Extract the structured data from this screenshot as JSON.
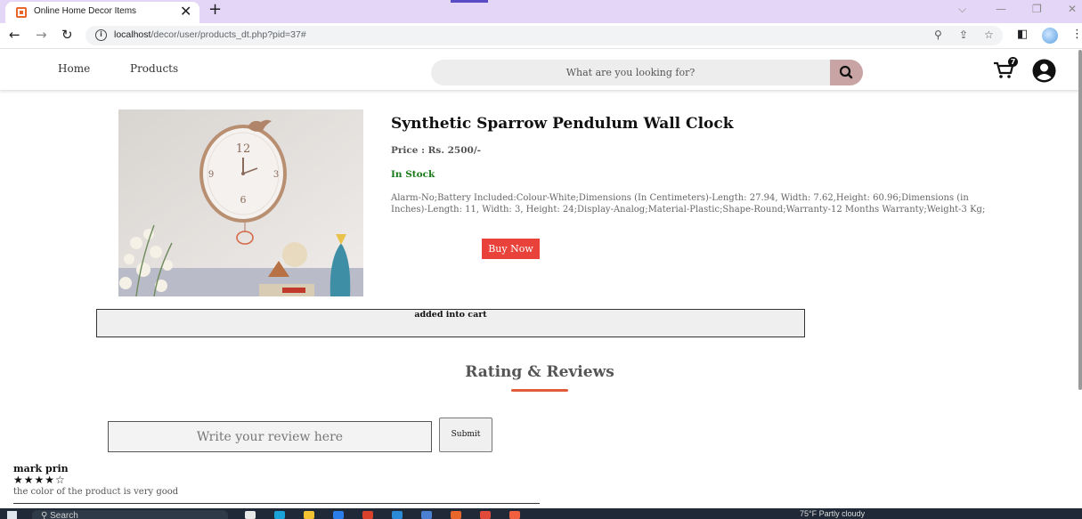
{
  "browser": {
    "tab_title": "Online Home Decor Items",
    "tab_close": "✕",
    "new_tab": "+",
    "url_host": "localhost",
    "url_path": "/decor/user/products_dt.php?pid=37#"
  },
  "header": {
    "nav": [
      "Home",
      "Products"
    ],
    "search_placeholder": "What are you looking for?",
    "cart_count": "7"
  },
  "product": {
    "title": "Synthetic Sparrow Pendulum Wall Clock",
    "price": "Price : Rs. 2500/-",
    "stock": "In Stock",
    "description": "Alarm-No;Battery Included:Colour-White;Dimensions (In Centimeters)-Length: 27.94, Width: 7.62,Height: 60.96;Dimensions (in Inches)-Length: 11, Width: 3, Height: 24;Display-Analog;Material-Plastic;Shape-Round;Warranty-12 Months Warranty;Weight-3 Kg;",
    "buy_label": "Buy Now"
  },
  "cart_message": "added into cart",
  "reviews": {
    "title": "Rating & Reviews",
    "input_placeholder": "Write your review here",
    "submit_label": "Submit",
    "items": [
      {
        "name": "mark prin",
        "stars": "★★★★☆",
        "rating": 4,
        "text": "the color of the product is very good"
      }
    ]
  },
  "taskbar": {
    "search_label": "Search",
    "weather": "75°F  Partly cloudy"
  },
  "colors": {
    "accent_red": "#e8423a",
    "in_stock": "#1a7a1a",
    "tab_strip": "#e3d6f6",
    "underline": "#e25c3c"
  }
}
